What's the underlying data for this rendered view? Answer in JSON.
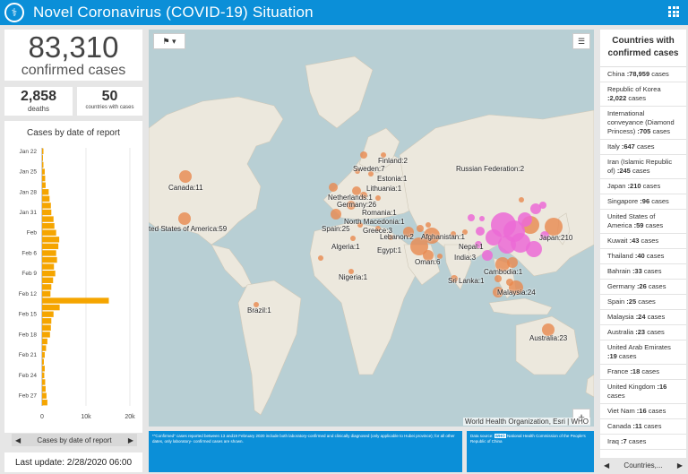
{
  "header": {
    "title": "Novel Coronavirus (COVID-19) Situation",
    "logo_icon": "who-logo-icon"
  },
  "summary": {
    "confirmed_num": "83,310",
    "confirmed_label": "confirmed cases",
    "deaths_num": "2,858",
    "deaths_label": "deaths",
    "countries_num": "50",
    "countries_label": "countries with cases"
  },
  "chart": {
    "title": "Cases by date of report",
    "footer_label": "Cases by date of report",
    "prev_icon": "chevron-left-icon",
    "next_icon": "chevron-right-icon"
  },
  "chart_data": {
    "type": "bar",
    "orientation": "horizontal",
    "title": "Cases by date of report",
    "ytick_labels": [
      "Jan 22",
      "Jan 25",
      "Jan 28",
      "Jan 31",
      "Feb",
      "Feb 6",
      "Feb 9",
      "Feb 12",
      "Feb 15",
      "Feb 18",
      "Feb 21",
      "Feb 24",
      "Feb 27"
    ],
    "xtick_labels": [
      "0",
      "10k",
      "20k"
    ],
    "xlim": [
      0,
      20000
    ],
    "categories": [
      "Jan 22",
      "Jan 23",
      "Jan 24",
      "Jan 25",
      "Jan 26",
      "Jan 27",
      "Jan 28",
      "Jan 29",
      "Jan 30",
      "Jan 31",
      "Feb 1",
      "Feb 2",
      "Feb 3",
      "Feb 4",
      "Feb 5",
      "Feb 6",
      "Feb 7",
      "Feb 8",
      "Feb 9",
      "Feb 10",
      "Feb 11",
      "Feb 12",
      "Feb 13",
      "Feb 14",
      "Feb 15",
      "Feb 16",
      "Feb 17",
      "Feb 18",
      "Feb 19",
      "Feb 20",
      "Feb 21",
      "Feb 22",
      "Feb 23",
      "Feb 24",
      "Feb 25",
      "Feb 26",
      "Feb 27",
      "Feb 28"
    ],
    "values": [
      300,
      150,
      300,
      600,
      700,
      800,
      1500,
      1700,
      2000,
      2100,
      2600,
      2800,
      3200,
      3900,
      3700,
      3200,
      3400,
      2700,
      3000,
      2500,
      2100,
      1900,
      15200,
      4000,
      2600,
      2100,
      2000,
      1800,
      1200,
      900,
      600,
      400,
      600,
      500,
      700,
      800,
      1000,
      1200
    ],
    "bar_color": "#f5a500"
  },
  "last_update": "Last update: 2/28/2020 06:00",
  "map": {
    "attribution": "World Health Organization, Esri | WHO",
    "zoom_in": "+",
    "zoom_out": "−",
    "labels": [
      {
        "text": "Finland:2",
        "name": "label-finland"
      },
      {
        "text": "Sweden:7",
        "name": "label-sweden"
      },
      {
        "text": "Estonia:1",
        "name": "label-estonia"
      },
      {
        "text": "Russian Federation:2",
        "name": "label-russia"
      },
      {
        "text": "Canada:11",
        "name": "label-canada"
      },
      {
        "text": "Netherlands:1",
        "name": "label-netherlands"
      },
      {
        "text": "Lithuania:1",
        "name": "label-lithuania"
      },
      {
        "text": "Germany:26",
        "name": "label-germany"
      },
      {
        "text": "Romania:1",
        "name": "label-romania"
      },
      {
        "text": "North Macedonia:1",
        "name": "label-north-macedonia"
      },
      {
        "text": "ted States of America:59",
        "name": "label-usa"
      },
      {
        "text": "Spain:25",
        "name": "label-spain"
      },
      {
        "text": "Greece:3",
        "name": "label-greece"
      },
      {
        "text": "Lebanon:2",
        "name": "label-lebanon"
      },
      {
        "text": "Afghanistan:1",
        "name": "label-afghanistan"
      },
      {
        "text": "Algeria:1",
        "name": "label-algeria"
      },
      {
        "text": "Egypt:1",
        "name": "label-egypt"
      },
      {
        "text": "Nepal:1",
        "name": "label-nepal"
      },
      {
        "text": "Japan:210",
        "name": "label-japan"
      },
      {
        "text": "India:3",
        "name": "label-india"
      },
      {
        "text": "Oman:6",
        "name": "label-oman"
      },
      {
        "text": "Cambodia:1",
        "name": "label-cambodia"
      },
      {
        "text": "Nigeria:1",
        "name": "label-nigeria"
      },
      {
        "text": "Sri Lanka:1",
        "name": "label-sri-lanka"
      },
      {
        "text": "Malaysia:24",
        "name": "label-malaysia"
      },
      {
        "text": "Brazil:1",
        "name": "label-brazil"
      },
      {
        "text": "Australia:23",
        "name": "label-australia"
      }
    ]
  },
  "footnote": "*\"Confirmed\" cases reported between 13 and19 February 2020 include both laboratory-confirmed and clinically diagnosed (only applicable to Hubei province); for all other dates, only laboratory- confirmed cases are shown.",
  "datasource": {
    "prefix": "Data source:",
    "badge": "WHO",
    "text": "National Health Commission of the People's Republic of China"
  },
  "countries": {
    "title": "Countries with confirmed cases",
    "items": [
      {
        "name": "China",
        "count": ":78,959",
        "unit": " cases"
      },
      {
        "name": "Republic of Korea",
        "count": ":2,022",
        "unit": " cases"
      },
      {
        "name": "International conveyance (Diamond Princess)",
        "count": ":705",
        "unit": " cases"
      },
      {
        "name": "Italy",
        "count": ":647",
        "unit": " cases"
      },
      {
        "name": "Iran (Islamic Republic of)",
        "count": ":245",
        "unit": " cases"
      },
      {
        "name": "Japan",
        "count": ":210",
        "unit": " cases"
      },
      {
        "name": "Singapore",
        "count": ":96",
        "unit": " cases"
      },
      {
        "name": "United States of America",
        "count": ":59",
        "unit": " cases"
      },
      {
        "name": "Kuwait",
        "count": ":43",
        "unit": " cases"
      },
      {
        "name": "Thailand",
        "count": ":40",
        "unit": " cases"
      },
      {
        "name": "Bahrain",
        "count": ":33",
        "unit": " cases"
      },
      {
        "name": "Germany",
        "count": ":26",
        "unit": " cases"
      },
      {
        "name": "Spain",
        "count": ":25",
        "unit": " cases"
      },
      {
        "name": "Malaysia",
        "count": ":24",
        "unit": " cases"
      },
      {
        "name": "Australia",
        "count": ":23",
        "unit": " cases"
      },
      {
        "name": "United Arab Emirates",
        "count": ":19",
        "unit": " cases"
      },
      {
        "name": "France",
        "count": ":18",
        "unit": " cases"
      },
      {
        "name": "United Kingdom",
        "count": ":16",
        "unit": " cases"
      },
      {
        "name": "Viet Nam",
        "count": ":16",
        "unit": " cases"
      },
      {
        "name": "Canada",
        "count": ":11",
        "unit": " cases"
      },
      {
        "name": "Iraq",
        "count": ":7",
        "unit": " cases"
      }
    ],
    "footer_label": "Countries,..."
  }
}
